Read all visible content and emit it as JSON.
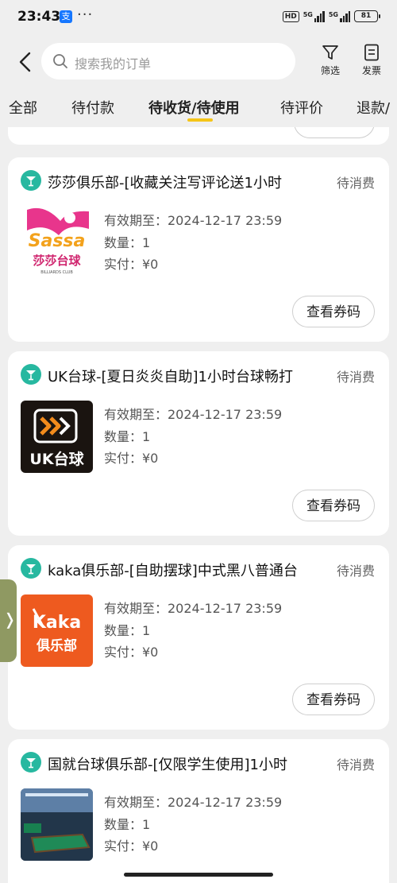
{
  "status_bar": {
    "time": "23:43",
    "app_badge": "支",
    "dots": "···",
    "hd": "HD",
    "sig1": "5G",
    "sig2": "5G",
    "battery": "81"
  },
  "header": {
    "search_placeholder": "搜索我的订单",
    "filter_label": "筛选",
    "invoice_label": "发票"
  },
  "tabs": [
    {
      "label": "全部"
    },
    {
      "label": "待付款"
    },
    {
      "label": "待收货/待使用"
    },
    {
      "label": "待评价"
    },
    {
      "label": "退款/"
    }
  ],
  "active_tab_color": "#f5c518",
  "orders": [
    {
      "title": "莎莎俱乐部-[收藏关注写评论送1小时",
      "status": "待消费",
      "valid": "有效期至：2024-12-17 23:59",
      "qty": "数量：1",
      "paid": "实付：¥0",
      "button": "查看券码",
      "logo": {
        "line1": "Sassa",
        "line2": "莎莎台球",
        "line3": "BILLIARDS CLUB"
      }
    },
    {
      "title": "UK台球-[夏日炎炎自助]1小时台球畅打",
      "status": "待消费",
      "valid": "有效期至：2024-12-17 23:59",
      "qty": "数量：1",
      "paid": "实付：¥0",
      "button": "查看券码",
      "logo": {
        "line1": "UK台球"
      }
    },
    {
      "title": "kaka俱乐部-[自助摆球]中式黑八普通台",
      "status": "待消费",
      "valid": "有效期至：2024-12-17 23:59",
      "qty": "数量：1",
      "paid": "实付：¥0",
      "button": "查看券码",
      "logo": {
        "line1": "Kaka",
        "line2": "俱乐部"
      }
    },
    {
      "title": "国就台球俱乐部-[仅限学生使用]1小时",
      "status": "待消费",
      "valid": "有效期至：2024-12-17 23:59",
      "qty": "数量：1",
      "paid": "实付：¥0"
    }
  ],
  "side_handle": "❭"
}
